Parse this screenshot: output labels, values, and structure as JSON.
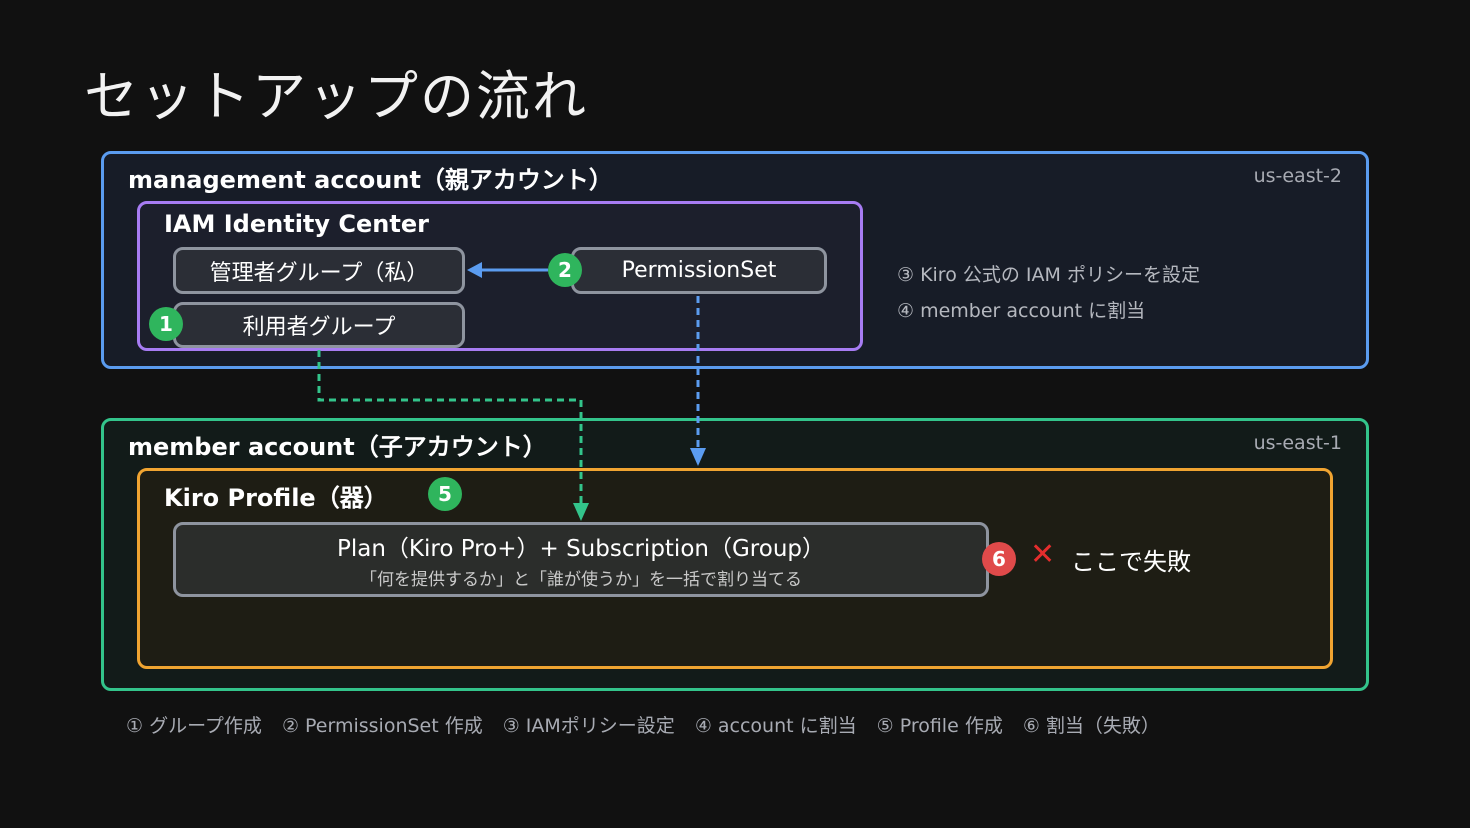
{
  "title": "セットアップの流れ",
  "management": {
    "title": "management account（親アカウント）",
    "region": "us-east-2",
    "iam_center": {
      "title": "IAM Identity Center",
      "admin_group": "管理者グループ（私）",
      "user_group": "利用者グループ",
      "permission_set": "PermissionSet"
    },
    "notes": [
      "③ Kiro 公式の IAM ポリシーを設定",
      "④ member account に割当"
    ]
  },
  "member": {
    "title": "member account（子アカウント）",
    "region": "us-east-1",
    "kiro_profile": {
      "title": "Kiro Profile（器）",
      "plan_main": "Plan（Kiro Pro+）+ Subscription（Group）",
      "plan_sub": "「何を提供するか」と「誰が使うか」を一括で割り当てる"
    },
    "failure": {
      "mark": "✕",
      "text": "ここで失敗"
    }
  },
  "badges": {
    "b1": "1",
    "b2": "2",
    "b5": "5",
    "b6": "6"
  },
  "legend": [
    "① グループ作成",
    "② PermissionSet 作成",
    "③ IAMポリシー設定",
    "④ account に割当",
    "⑤ Profile 作成",
    "⑥ 割当（失敗）"
  ],
  "colors": {
    "background": "#111111",
    "management_border": "#5b9cf0",
    "member_border": "#33c48b",
    "iam_border": "#a77cf3",
    "kiro_border": "#f0a431",
    "badge_green": "#2fb55d",
    "badge_red": "#e04a4a",
    "fail_mark": "#e52d2d"
  }
}
